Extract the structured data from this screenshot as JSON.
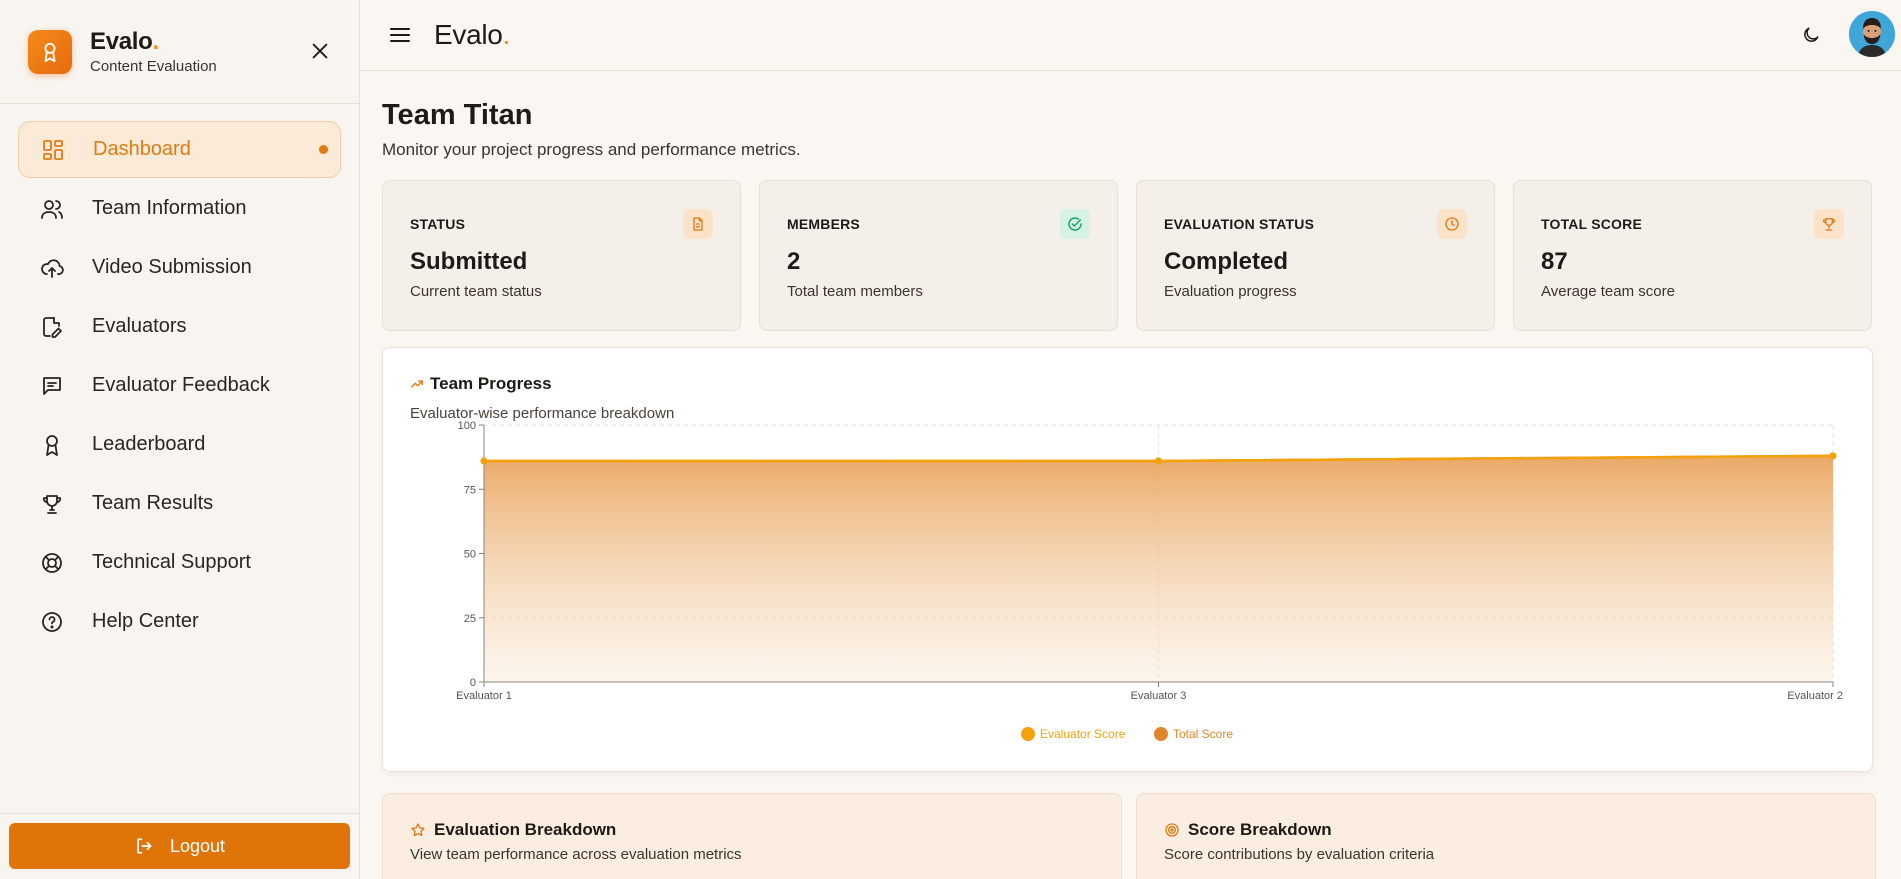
{
  "brand": {
    "name": "Evalo",
    "dot": ".",
    "subtitle": "Content Evaluation"
  },
  "topbar": {
    "brand": "Evalo",
    "dot": "."
  },
  "nav": [
    {
      "label": "Dashboard",
      "icon": "dashboard-icon",
      "active": true
    },
    {
      "label": "Team Information",
      "icon": "users-icon"
    },
    {
      "label": "Video Submission",
      "icon": "cloud-upload-icon"
    },
    {
      "label": "Evaluators",
      "icon": "file-edit-icon"
    },
    {
      "label": "Evaluator Feedback",
      "icon": "message-icon"
    },
    {
      "label": "Leaderboard",
      "icon": "award-icon"
    },
    {
      "label": "Team Results",
      "icon": "trophy-icon"
    },
    {
      "label": "Technical Support",
      "icon": "lifebuoy-icon"
    },
    {
      "label": "Help Center",
      "icon": "help-circle-icon"
    }
  ],
  "logout": {
    "label": "Logout"
  },
  "page": {
    "title": "Team Titan",
    "subtitle": "Monitor your project progress and performance metrics."
  },
  "stats": [
    {
      "label": "STATUS",
      "value": "Submitted",
      "desc": "Current team status",
      "icon": "document-icon"
    },
    {
      "label": "MEMBERS",
      "value": "2",
      "desc": "Total team members",
      "icon": "check-circle-icon"
    },
    {
      "label": "EVALUATION STATUS",
      "value": "Completed",
      "desc": "Evaluation progress",
      "icon": "clock-icon"
    },
    {
      "label": "TOTAL SCORE",
      "value": "87",
      "desc": "Average team score",
      "icon": "trophy-icon"
    }
  ],
  "progress": {
    "title": "Team Progress",
    "subtitle": "Evaluator-wise performance breakdown"
  },
  "chart_data": {
    "type": "area",
    "categories": [
      "Evaluator 1",
      "Evaluator 3",
      "Evaluator 2"
    ],
    "series": [
      {
        "name": "Evaluator Score",
        "values": [
          86,
          86,
          88
        ],
        "color": "#f4a20c"
      },
      {
        "name": "Total Score",
        "values": [
          86,
          86,
          88
        ],
        "color": "#e0852a"
      }
    ],
    "yticks": [
      0,
      25,
      50,
      75,
      100
    ],
    "ylim": [
      0,
      100
    ],
    "grid": true,
    "legend": "bottom"
  },
  "breakdown": [
    {
      "title": "Evaluation Breakdown",
      "subtitle": "View team performance across evaluation metrics",
      "icon": "star-icon"
    },
    {
      "title": "Score Breakdown",
      "subtitle": "Score contributions by evaluation criteria",
      "icon": "target-icon"
    }
  ],
  "colors": {
    "accent": "#df7409",
    "accentLight": "#fcead8",
    "chartLine": "#f4a20c"
  }
}
